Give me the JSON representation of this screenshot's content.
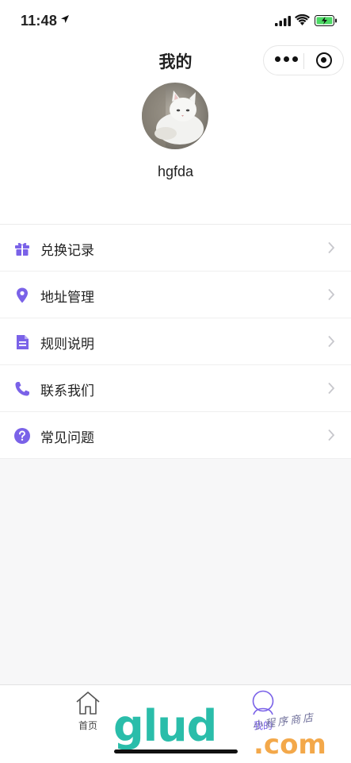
{
  "status_bar": {
    "time": "11:48"
  },
  "nav": {
    "title": "我的"
  },
  "profile": {
    "username": "hgfda"
  },
  "menu": [
    {
      "label": "兑换记录",
      "icon": "gift-icon"
    },
    {
      "label": "地址管理",
      "icon": "location-pin-icon"
    },
    {
      "label": "规则说明",
      "icon": "document-icon"
    },
    {
      "label": "联系我们",
      "icon": "phone-icon"
    },
    {
      "label": "常见问题",
      "icon": "question-circle-icon"
    }
  ],
  "tabbar": {
    "home_label": "首页",
    "mine_label": "我的"
  },
  "watermark": {
    "main": "glud",
    "suffix": ".com",
    "caption": "小程序商店"
  },
  "colors": {
    "accent": "#7a62e8",
    "text": "#222222",
    "chevron": "#c7c7cc"
  }
}
